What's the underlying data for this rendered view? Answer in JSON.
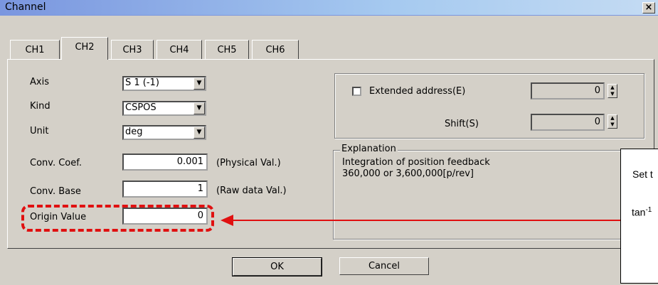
{
  "window": {
    "title": "Channel",
    "close_label": "×"
  },
  "tabs": [
    {
      "label": "CH1",
      "active": false
    },
    {
      "label": "CH2",
      "active": true
    },
    {
      "label": "CH3",
      "active": false
    },
    {
      "label": "CH4",
      "active": false
    },
    {
      "label": "CH5",
      "active": false
    },
    {
      "label": "CH6",
      "active": false
    }
  ],
  "form": {
    "axis_label": "Axis",
    "axis_value": "S 1 (-1)",
    "kind_label": "Kind",
    "kind_value": "CSPOS",
    "unit_label": "Unit",
    "unit_value": "deg",
    "conv_coef_label": "Conv. Coef.",
    "conv_coef_value": "0.001",
    "conv_coef_note": "(Physical Val.)",
    "conv_base_label": "Conv. Base",
    "conv_base_value": "1",
    "conv_base_note": "(Raw data Val.)",
    "origin_label": "Origin Value",
    "origin_value": "0"
  },
  "extended": {
    "checkbox_label": "Extended address(E)",
    "address_value": "0",
    "shift_label": "Shift(S)",
    "shift_value": "0"
  },
  "explanation": {
    "title": "Explanation",
    "line1": "Integration of position feedback",
    "line2": "360,000 or 3,600,000[p/rev]"
  },
  "buttons": {
    "ok": "OK",
    "cancel": "Cancel"
  },
  "callout": {
    "line1": "Set t",
    "line2": "tan",
    "sup": "-1"
  },
  "colors": {
    "annotation": "#e01010",
    "dialog_bg": "#d4d0c8"
  }
}
